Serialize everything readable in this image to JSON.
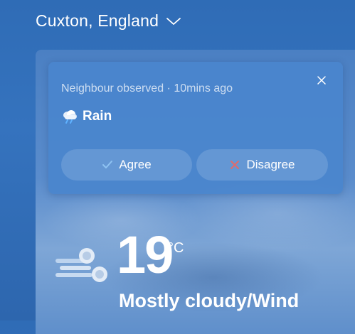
{
  "location": {
    "label": "Cuxton, England",
    "dropdown_icon": "chevron-down-icon"
  },
  "observation": {
    "meta": "Neighbour observed · 10mins ago",
    "condition": "Rain",
    "condition_icon": "rain-cloud-icon",
    "agree_label": "Agree",
    "disagree_label": "Disagree",
    "agree_icon": "checkmark-icon",
    "disagree_icon": "cross-icon",
    "close_icon": "close-icon"
  },
  "current": {
    "temperature": "19",
    "unit": "°C",
    "summary": "Mostly cloudy/Wind",
    "condition_icon": "wind-icon"
  },
  "colors": {
    "background": "#2f6cb6",
    "card": "#4a86cd",
    "agree_check": "#8fc3f2",
    "disagree_cross": "#e06b6b"
  }
}
